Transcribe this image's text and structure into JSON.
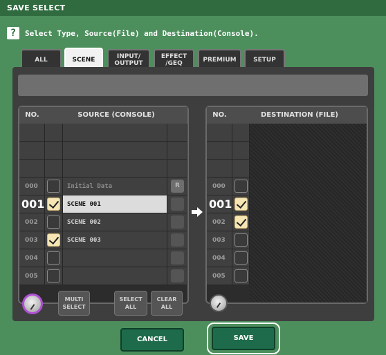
{
  "window": {
    "title": "SAVE SELECT"
  },
  "instruction": {
    "icon": "?",
    "text": "Select Type, Source(File) and Destination(Console)."
  },
  "tabs": [
    {
      "label": "ALL",
      "active": false
    },
    {
      "label": "SCENE",
      "active": true
    },
    {
      "label": "INPUT/\nOUTPUT",
      "active": false
    },
    {
      "label": "EFFECT\n/GEQ",
      "active": false
    },
    {
      "label": "PREMIUM",
      "active": false
    },
    {
      "label": "SETUP",
      "active": false
    }
  ],
  "source": {
    "header_no": "NO.",
    "header_title": "SOURCE (CONSOLE)",
    "rows": [
      {
        "no": "",
        "checked": false,
        "name": ""
      },
      {
        "no": "",
        "checked": false,
        "name": ""
      },
      {
        "no": "",
        "checked": false,
        "name": ""
      },
      {
        "no": "000",
        "checked": false,
        "name": "Initial Data",
        "badge": "R"
      },
      {
        "no": "001",
        "checked": true,
        "name": "SCENE 001",
        "selected": true
      },
      {
        "no": "002",
        "checked": false,
        "name": "SCENE 002"
      },
      {
        "no": "003",
        "checked": true,
        "name": "SCENE 003"
      },
      {
        "no": "004",
        "checked": false,
        "name": ""
      },
      {
        "no": "005",
        "checked": false,
        "name": ""
      }
    ],
    "buttons": {
      "multi_select": "MULTI\nSELECT",
      "select_all": "SELECT\nALL",
      "clear_all": "CLEAR\nALL"
    }
  },
  "destination": {
    "header_no": "NO.",
    "header_title": "DESTINATION (FILE)",
    "rows": [
      {
        "no": "",
        "checked": false
      },
      {
        "no": "",
        "checked": false
      },
      {
        "no": "",
        "checked": false
      },
      {
        "no": "000",
        "checked": false
      },
      {
        "no": "001",
        "checked": true,
        "selected": true
      },
      {
        "no": "002",
        "checked": true
      },
      {
        "no": "003",
        "checked": false
      },
      {
        "no": "004",
        "checked": false
      },
      {
        "no": "005",
        "checked": false
      }
    ]
  },
  "actions": {
    "cancel": "CANCEL",
    "save": "SAVE"
  },
  "colors": {
    "frame": "#4c8f5c",
    "titlebar": "#2f6b3f",
    "button": "#1d6b4a",
    "check": "#f5e6b4"
  }
}
